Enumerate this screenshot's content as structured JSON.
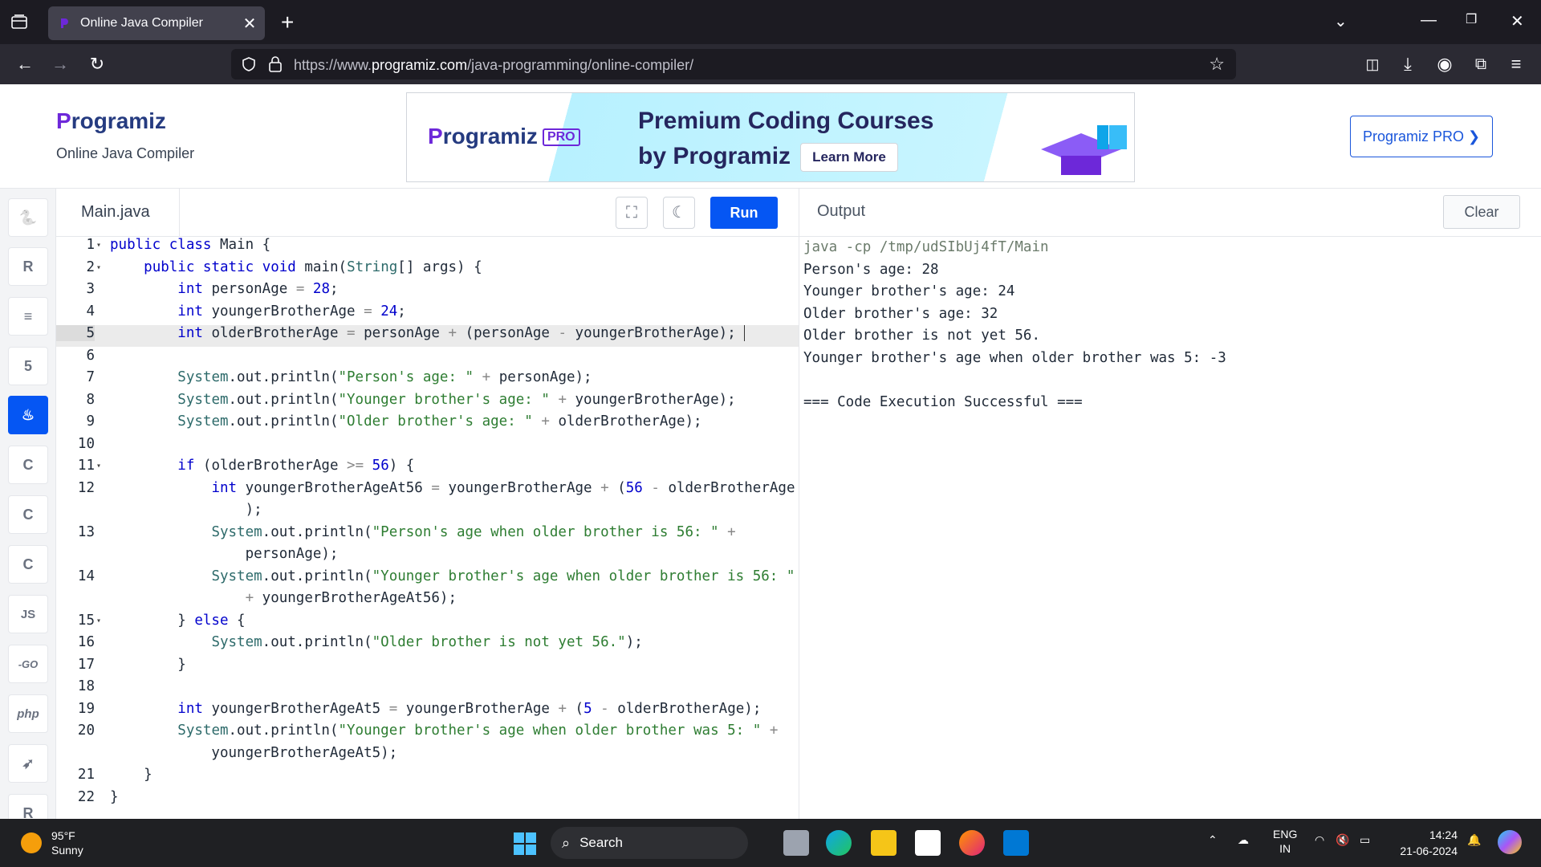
{
  "browser": {
    "tab_title": "Online Java Compiler",
    "tab_close": "✕",
    "new_tab": "+",
    "url_prefix": "https://www.",
    "url_domain": "programiz.com",
    "url_path": "/java-programming/online-compiler/"
  },
  "header": {
    "logo_p": "P",
    "logo_rest": "rogramiz",
    "subtitle": "Online Java Compiler",
    "banner": {
      "logo_p": "P",
      "logo_rest": "rogramiz",
      "pro_tag": "PRO",
      "line1": "Premium Coding Courses",
      "line2": "by Programiz",
      "learn_more": "Learn More"
    },
    "pro_button": "Programiz PRO ❯"
  },
  "sidebar": {
    "languages": [
      {
        "name": "python",
        "glyph": "🐍"
      },
      {
        "name": "r",
        "glyph": "R"
      },
      {
        "name": "sql",
        "glyph": "≡"
      },
      {
        "name": "html",
        "glyph": "5"
      },
      {
        "name": "java",
        "glyph": "♨"
      },
      {
        "name": "c",
        "glyph": "C"
      },
      {
        "name": "cpp",
        "glyph": "C"
      },
      {
        "name": "csharp",
        "glyph": "C"
      },
      {
        "name": "js",
        "glyph": "JS"
      },
      {
        "name": "go",
        "glyph": "-GO"
      },
      {
        "name": "php",
        "glyph": "php"
      },
      {
        "name": "swift",
        "glyph": "➶"
      },
      {
        "name": "rust",
        "glyph": "R"
      }
    ],
    "active": "java"
  },
  "editor": {
    "file_tab": "Main.java",
    "run_label": "Run",
    "highlighted_line": 5
  },
  "output": {
    "title": "Output",
    "clear_label": "Clear",
    "lines": [
      "java -cp /tmp/udSIbUj4fT/Main",
      "Person's age: 28",
      "Younger brother's age: 24",
      "Older brother's age: 32",
      "Older brother is not yet 56.",
      "Younger brother's age when older brother was 5: -3",
      "",
      "=== Code Execution Successful ==="
    ]
  },
  "taskbar": {
    "temp": "95°F",
    "condition": "Sunny",
    "search_label": "Search",
    "lang_line1": "ENG",
    "lang_line2": "IN",
    "time": "14:24",
    "date": "21-06-2024"
  }
}
